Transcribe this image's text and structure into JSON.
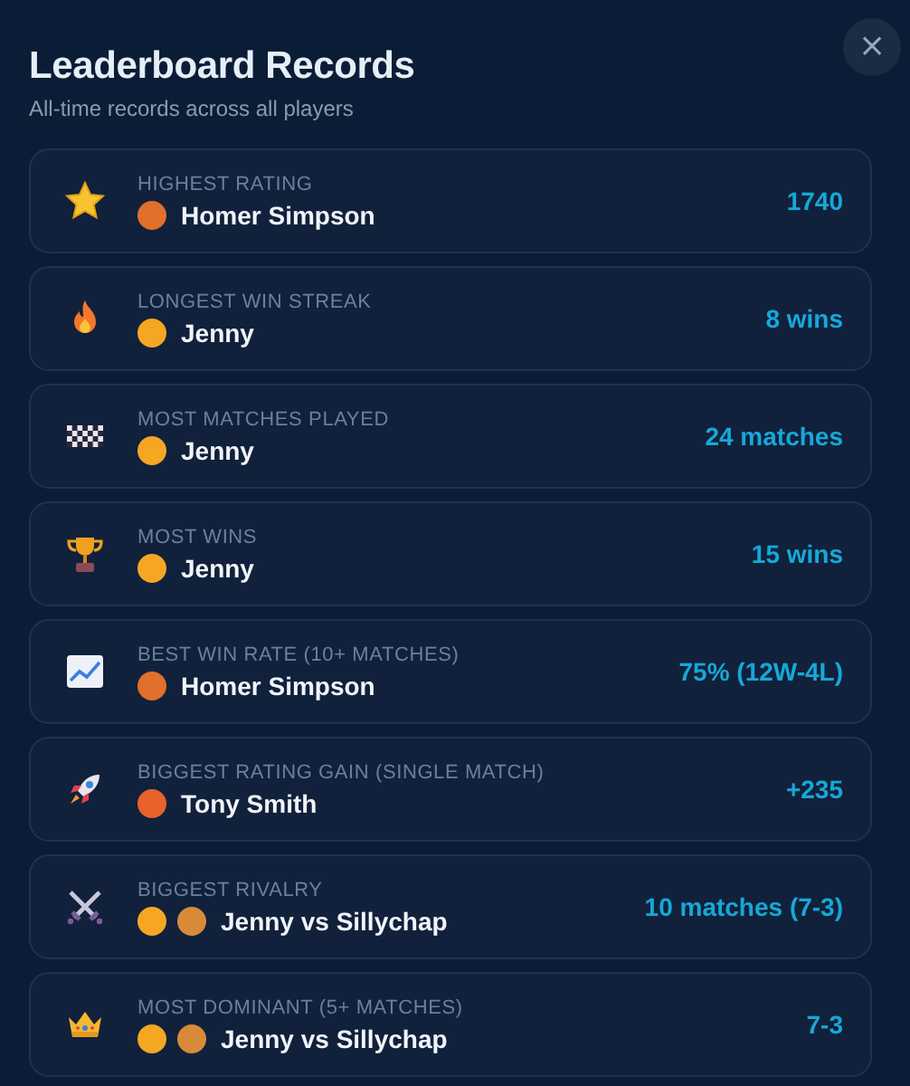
{
  "header": {
    "title": "Leaderboard **Records**",
    "subtitle": "All-time records across all players",
    "close": "×"
  },
  "records": [
    {
      "label": "HIGHEST RATING",
      "player": "Homer Simpson",
      "avatars": [
        {
          "color": "#e0702a"
        }
      ],
      "value": "1740"
    },
    {
      "label": "LONGEST WIN STREAK",
      "player": "Jenny",
      "avatars": [
        {
          "color": "#f5a623"
        }
      ],
      "value": "8 wins"
    },
    {
      "label": "MOST MATCHES PLAYED",
      "player": "Jenny",
      "avatars": [
        {
          "color": "#f5a623"
        }
      ],
      "value": "24 matches"
    },
    {
      "label": "MOST WINS",
      "player": "Jenny",
      "avatars": [
        {
          "color": "#f5a623"
        }
      ],
      "value": "15 wins"
    },
    {
      "label": "BEST WIN RATE (10+ MATCHES)",
      "player": "Homer Simpson",
      "avatars": [
        {
          "color": "#e0702a"
        }
      ],
      "value": "75% (12W-4L)"
    },
    {
      "label": "BIGGEST RATING GAIN (SINGLE MATCH)",
      "player": "Tony Smith",
      "avatars": [
        {
          "color": "#e8622a"
        }
      ],
      "value": "+235"
    },
    {
      "label": "BIGGEST RIVALRY",
      "player": "Jenny vs Sillychap",
      "avatars": [
        {
          "color": "#f5a623"
        },
        {
          "color": "#d9893a"
        }
      ],
      "value": "10 matches (7-3)"
    },
    {
      "label": "MOST DOMINANT (5+ MATCHES)",
      "player": "Jenny vs Sillychap",
      "avatars": [
        {
          "color": "#f5a623"
        },
        {
          "color": "#d9893a"
        }
      ],
      "value": "7-3"
    }
  ]
}
